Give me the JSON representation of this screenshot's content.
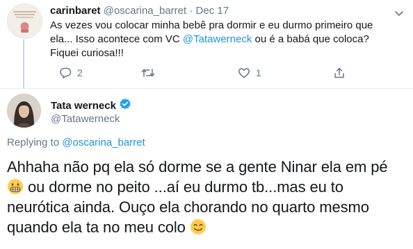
{
  "reply_tweet": {
    "display_name": "carinbaret",
    "handle": "@oscarina_barret",
    "separator": "·",
    "date": "Dec 17",
    "text_before_mention": "As vezes vou colocar minha bebê pra dormir e eu durmo primeiro que ela... Isso acontece com VC ",
    "mention": "@Tatawerneck",
    "text_after_mention": " ou é a babá que coloca? Fiquei curiosa!!!",
    "reply_count": "2",
    "like_count": "1",
    "icons": [
      "reply-icon",
      "retweet-icon",
      "like-icon",
      "share-icon",
      "chevron-down-icon"
    ]
  },
  "main_tweet": {
    "display_name": "Tata werneck",
    "handle": "@Tatawerneck",
    "replying_prefix": "Replying to ",
    "replying_handle": "@oscarina_barret",
    "text_part1": "Ahhaha não pq ela só dorme se a gente Ninar ela em pé ",
    "text_part2": " ou dorme no peito ...aí eu durmo tb...mas eu to neurótica ainda. Ouço ela chorando no quarto mesmo quando ela ta no meu colo ",
    "emojis": [
      "grimacing-emoji",
      "savoring-food-emoji"
    ],
    "verified_icon": "verified-badge-icon"
  },
  "colors": {
    "link": "#1b95e0",
    "muted": "#657786",
    "text": "#14171a",
    "divider": "#e6ecf0",
    "thread_line": "#ccd6dd",
    "verified": "#1da1f2"
  }
}
